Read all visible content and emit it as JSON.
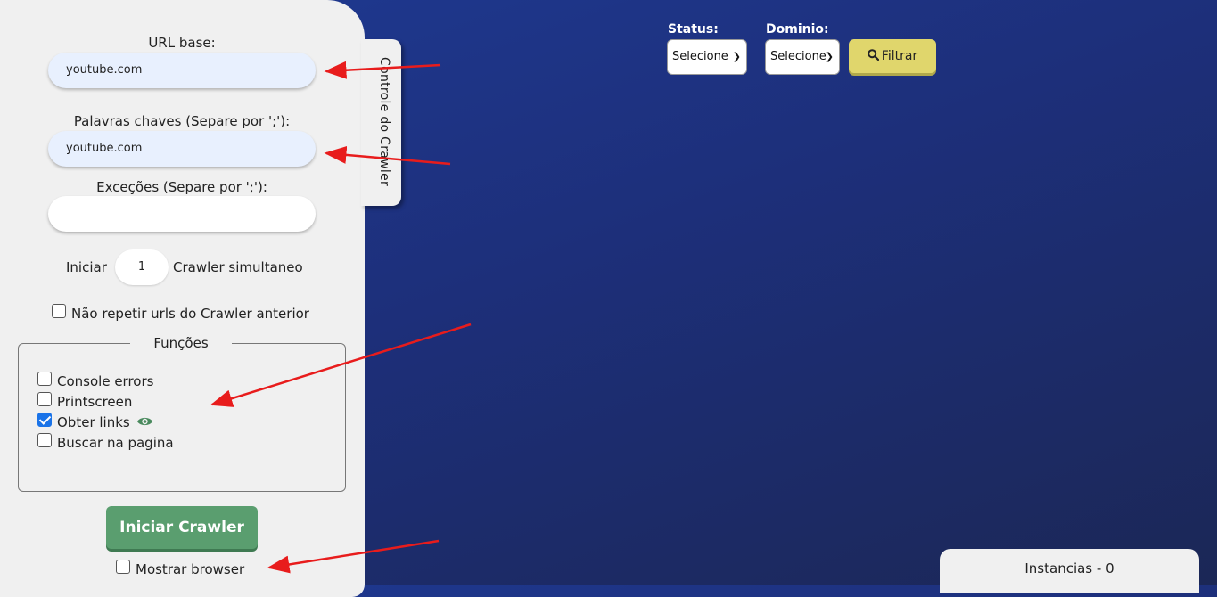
{
  "panel": {
    "tab_label": "Controle do Crawler",
    "url_base_label": "URL base:",
    "url_base_value": "youtube.com",
    "keywords_label": "Palavras chaves (Separe por ';'):",
    "keywords_value": "youtube.com",
    "exceptions_label": "Exceções (Separe por ';'):",
    "exceptions_value": "",
    "simultaneous_prefix": "Iniciar",
    "simultaneous_value": "1",
    "simultaneous_suffix": "Crawler simultaneo",
    "no_repeat_label": "Não repetir urls do Crawler anterior",
    "no_repeat_checked": false,
    "functions_legend": "Funções",
    "functions": [
      {
        "label": "Console errors",
        "checked": false
      },
      {
        "label": "Printscreen",
        "checked": false
      },
      {
        "label": "Obter links",
        "checked": true
      },
      {
        "label": "Buscar na pagina",
        "checked": false
      }
    ],
    "start_button": "Iniciar Crawler",
    "show_browser_label": "Mostrar browser",
    "show_browser_checked": false
  },
  "filters": {
    "status_label": "Status:",
    "status_selected": "Selecione",
    "domain_label": "Dominio:",
    "domain_selected": "Selecione",
    "filter_button": "Filtrar"
  },
  "instances": {
    "label": "Instancias - 0"
  },
  "colors": {
    "background": "#1f3a93",
    "start_button": "#5a9e6f",
    "filter_button": "#e0d66c",
    "checkbox_checked": "#1a73e8",
    "eye_icon": "#4a8a5e",
    "arrow": "#e81c1c"
  }
}
